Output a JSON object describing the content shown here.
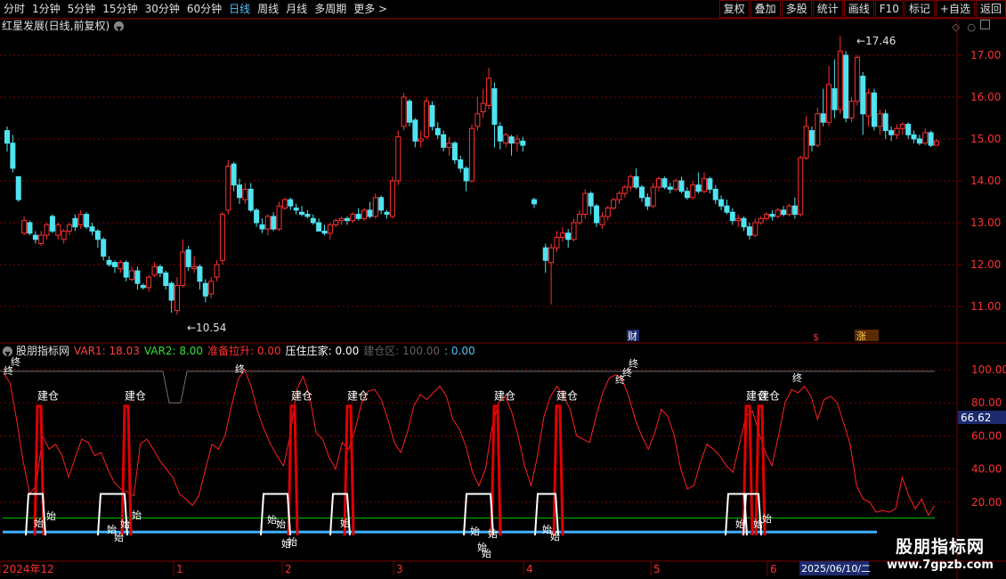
{
  "toolbar": {
    "periods": [
      "分时",
      "1分钟",
      "5分钟",
      "15分钟",
      "30分钟",
      "60分钟",
      "日线",
      "周线",
      "月线",
      "多周期",
      "更多 >"
    ],
    "active_period": "日线",
    "buttons": [
      "复权",
      "叠加",
      "多股",
      "统计",
      "画线",
      "F10",
      "标记",
      "+自选",
      "返回"
    ]
  },
  "chart_title": "红星发展(日线,前复权)",
  "indicator": {
    "name": "股朋指标网",
    "var1": "VAR1: 18.03",
    "var2": "VAR2: 8.00",
    "prep": "准备拉升: 0.00",
    "press": "压住庄家: 0.00",
    "build": "建仓区: 100.00",
    "extra": ": 0.00"
  },
  "price_axis": [
    "17.00",
    "16.00",
    "15.00",
    "14.00",
    "13.00",
    "12.00",
    "11.00"
  ],
  "ind_axis": [
    "100.00",
    "80.00",
    "60.00",
    "40.00",
    "20.00"
  ],
  "ind_current": "66.62",
  "hi_label": "17.46",
  "lo_label": "10.54",
  "markers": {
    "cai": "财",
    "s": "$",
    "zhang": "涨"
  },
  "signals": {
    "jian": "建仓",
    "shi": "始",
    "zhong": "终"
  },
  "date_axis": [
    "2024年12",
    "1",
    "2",
    "3",
    "4",
    "5",
    "6"
  ],
  "date_current": "2025/06/10/二",
  "watermark": {
    "line1": "股朋指标网",
    "line2": "www.7gpzb.com"
  },
  "colors": {
    "up": "#ff3030",
    "down": "#4fe3f0",
    "grid": "#7a0000",
    "ma": "#ff2020",
    "green": "#00c000",
    "blue": "#3fb0ff"
  },
  "candles": [
    [
      15.2,
      14.9,
      15.3,
      14.7
    ],
    [
      14.9,
      14.3,
      15.1,
      14.2
    ],
    [
      14.1,
      13.55,
      14.1,
      13.5
    ],
    [
      12.75,
      13.05,
      13.15,
      12.7
    ],
    [
      13.0,
      12.75,
      13.05,
      12.7
    ],
    [
      12.7,
      12.6,
      12.8,
      12.5
    ],
    [
      12.5,
      12.7,
      12.8,
      12.45
    ],
    [
      12.7,
      12.95,
      13.0,
      12.6
    ],
    [
      13.15,
      12.8,
      13.2,
      12.75
    ],
    [
      12.7,
      12.95,
      13.0,
      12.6
    ],
    [
      12.6,
      12.8,
      12.85,
      12.5
    ],
    [
      12.8,
      12.95,
      13.0,
      12.7
    ],
    [
      13.1,
      12.9,
      13.2,
      12.8
    ],
    [
      12.95,
      13.2,
      13.3,
      12.85
    ],
    [
      13.2,
      12.9,
      13.25,
      12.85
    ],
    [
      12.9,
      12.8,
      13.0,
      12.7
    ],
    [
      12.8,
      12.6,
      12.85,
      12.4
    ],
    [
      12.6,
      12.2,
      12.65,
      12.1
    ],
    [
      12.1,
      12.0,
      12.2,
      11.95
    ],
    [
      12.05,
      11.95,
      12.1,
      11.8
    ],
    [
      11.9,
      12.05,
      12.1,
      11.8
    ],
    [
      12.05,
      11.7,
      12.1,
      11.6
    ],
    [
      11.65,
      11.85,
      11.95,
      11.6
    ],
    [
      11.85,
      11.55,
      11.95,
      11.4
    ],
    [
      11.5,
      11.45,
      11.55,
      11.4
    ],
    [
      11.45,
      11.7,
      11.75,
      11.35
    ],
    [
      11.75,
      11.95,
      12.05,
      11.7
    ],
    [
      11.95,
      11.8,
      12.0,
      11.7
    ],
    [
      11.8,
      11.5,
      11.85,
      11.4
    ],
    [
      11.55,
      11.15,
      11.6,
      10.85
    ],
    [
      10.9,
      11.5,
      11.7,
      10.8
    ],
    [
      11.5,
      12.3,
      12.6,
      11.45
    ],
    [
      12.35,
      11.95,
      12.45,
      11.85
    ],
    [
      11.9,
      11.95,
      12.2,
      11.8
    ],
    [
      11.95,
      11.6,
      12.0,
      11.4
    ],
    [
      11.55,
      11.25,
      11.65,
      11.1
    ],
    [
      11.3,
      11.6,
      11.7,
      11.2
    ],
    [
      11.7,
      12.0,
      12.1,
      11.6
    ],
    [
      12.1,
      13.2,
      13.25,
      12.0
    ],
    [
      13.3,
      14.35,
      14.5,
      13.2
    ],
    [
      14.4,
      13.9,
      14.45,
      13.75
    ],
    [
      13.9,
      13.6,
      14.05,
      13.45
    ],
    [
      13.55,
      13.8,
      13.95,
      13.45
    ],
    [
      13.8,
      13.3,
      13.95,
      13.25
    ],
    [
      13.3,
      13.0,
      13.35,
      12.9
    ],
    [
      12.95,
      12.85,
      13.1,
      12.75
    ],
    [
      12.85,
      13.15,
      13.2,
      12.7
    ],
    [
      13.15,
      12.85,
      13.25,
      12.8
    ],
    [
      12.85,
      13.4,
      13.5,
      12.8
    ],
    [
      13.35,
      13.55,
      13.6,
      13.3
    ],
    [
      13.55,
      13.4,
      13.6,
      13.3
    ],
    [
      13.35,
      13.3,
      13.45,
      13.2
    ],
    [
      13.25,
      13.2,
      13.4,
      13.15
    ],
    [
      13.2,
      13.15,
      13.3,
      13.1
    ],
    [
      13.1,
      13.0,
      13.2,
      12.95
    ],
    [
      13.0,
      12.8,
      13.1,
      12.8
    ],
    [
      12.8,
      12.75,
      12.95,
      12.7
    ],
    [
      12.75,
      12.95,
      13.0,
      12.6
    ],
    [
      12.95,
      13.05,
      13.1,
      12.9
    ],
    [
      13.05,
      13.1,
      13.15,
      12.95
    ],
    [
      13.1,
      13.05,
      13.15,
      12.95
    ],
    [
      13.05,
      13.2,
      13.25,
      13.0
    ],
    [
      13.2,
      13.1,
      13.35,
      13.05
    ],
    [
      13.1,
      13.3,
      13.35,
      13.05
    ],
    [
      13.3,
      13.15,
      13.5,
      13.1
    ],
    [
      13.15,
      13.6,
      13.7,
      13.1
    ],
    [
      13.6,
      13.3,
      13.65,
      13.2
    ],
    [
      13.25,
      13.2,
      13.3,
      13.1
    ],
    [
      13.15,
      14.0,
      14.1,
      13.1
    ],
    [
      14.0,
      15.05,
      15.2,
      13.9
    ],
    [
      15.3,
      16.0,
      16.1,
      15.2
    ],
    [
      15.9,
      15.4,
      15.95,
      15.3
    ],
    [
      15.45,
      14.95,
      15.5,
      14.8
    ],
    [
      14.95,
      15.0,
      15.2,
      14.8
    ],
    [
      15.05,
      15.9,
      16.0,
      15.0
    ],
    [
      15.8,
      15.3,
      15.9,
      15.2
    ],
    [
      15.25,
      15.1,
      15.4,
      15.0
    ],
    [
      15.1,
      14.8,
      15.2,
      14.7
    ],
    [
      14.8,
      14.9,
      15.05,
      14.6
    ],
    [
      14.9,
      14.5,
      14.95,
      14.4
    ],
    [
      14.5,
      14.3,
      14.6,
      14.2
    ],
    [
      14.3,
      14.0,
      14.35,
      13.75
    ],
    [
      14.0,
      15.25,
      15.35,
      13.95
    ],
    [
      15.3,
      15.6,
      16.0,
      15.2
    ],
    [
      15.65,
      15.85,
      16.2,
      15.5
    ],
    [
      15.8,
      16.45,
      16.7,
      15.7
    ],
    [
      16.2,
      15.35,
      16.35,
      14.8
    ],
    [
      15.3,
      14.95,
      15.4,
      14.75
    ],
    [
      14.9,
      15.1,
      15.15,
      14.8
    ],
    [
      15.05,
      14.9,
      15.1,
      14.6
    ],
    [
      14.9,
      15.0,
      15.1,
      14.7
    ],
    [
      14.95,
      14.85,
      15.05,
      14.7
    ],
    [
      null,
      null,
      null,
      null
    ],
    [
      13.55,
      13.45,
      13.6,
      13.35
    ],
    [
      null,
      null,
      null,
      null
    ],
    [
      12.4,
      12.1,
      12.5,
      11.8
    ],
    [
      12.05,
      12.4,
      12.5,
      11.05
    ],
    [
      12.4,
      12.65,
      12.8,
      12.3
    ],
    [
      12.65,
      12.75,
      12.9,
      12.55
    ],
    [
      12.75,
      12.6,
      12.85,
      12.4
    ],
    [
      12.6,
      13.0,
      13.1,
      12.55
    ],
    [
      13.0,
      13.2,
      13.3,
      12.95
    ],
    [
      13.2,
      13.7,
      13.8,
      13.1
    ],
    [
      13.7,
      13.4,
      13.75,
      13.2
    ],
    [
      13.4,
      13.0,
      13.45,
      12.9
    ],
    [
      12.95,
      13.15,
      13.25,
      12.85
    ],
    [
      13.15,
      13.35,
      13.4,
      13.05
    ],
    [
      13.35,
      13.55,
      13.6,
      13.3
    ],
    [
      13.55,
      13.7,
      13.75,
      13.45
    ],
    [
      13.7,
      13.85,
      13.9,
      13.6
    ],
    [
      13.85,
      14.1,
      14.15,
      13.75
    ],
    [
      14.1,
      13.85,
      14.3,
      13.8
    ],
    [
      13.85,
      13.6,
      13.9,
      13.5
    ],
    [
      13.6,
      13.4,
      13.7,
      13.3
    ],
    [
      13.4,
      13.85,
      13.95,
      13.35
    ],
    [
      13.85,
      14.05,
      14.1,
      13.75
    ],
    [
      14.05,
      13.85,
      14.1,
      13.8
    ],
    [
      13.85,
      13.8,
      13.95,
      13.7
    ],
    [
      13.8,
      14.0,
      14.05,
      13.75
    ],
    [
      14.0,
      13.75,
      14.1,
      13.7
    ],
    [
      13.75,
      13.6,
      13.85,
      13.55
    ],
    [
      13.6,
      13.9,
      14.0,
      13.55
    ],
    [
      13.9,
      13.75,
      14.2,
      13.7
    ],
    [
      13.75,
      14.05,
      14.2,
      13.7
    ],
    [
      14.05,
      13.8,
      14.1,
      13.7
    ],
    [
      13.8,
      13.55,
      13.9,
      13.45
    ],
    [
      13.55,
      13.4,
      13.65,
      13.3
    ],
    [
      13.4,
      13.25,
      13.55,
      13.2
    ],
    [
      13.25,
      13.05,
      13.35,
      12.95
    ],
    [
      13.05,
      13.1,
      13.2,
      12.9
    ],
    [
      13.1,
      12.9,
      13.15,
      12.8
    ],
    [
      12.9,
      12.7,
      13.0,
      12.6
    ],
    [
      12.7,
      13.0,
      13.1,
      12.65
    ],
    [
      13.0,
      13.1,
      13.15,
      12.95
    ],
    [
      13.1,
      13.2,
      13.25,
      13.05
    ],
    [
      13.2,
      13.15,
      13.3,
      13.05
    ],
    [
      13.15,
      13.3,
      13.35,
      13.1
    ],
    [
      13.3,
      13.2,
      13.4,
      13.15
    ],
    [
      13.2,
      13.4,
      13.45,
      13.15
    ],
    [
      13.4,
      13.2,
      13.6,
      13.1
    ],
    [
      13.2,
      14.55,
      14.6,
      13.15
    ],
    [
      14.55,
      15.3,
      15.55,
      14.5
    ],
    [
      15.2,
      14.85,
      15.3,
      14.7
    ],
    [
      14.85,
      15.6,
      15.75,
      14.8
    ],
    [
      15.6,
      15.4,
      16.2,
      15.3
    ],
    [
      15.4,
      16.3,
      16.75,
      15.3
    ],
    [
      16.2,
      15.7,
      16.9,
      15.5
    ],
    [
      15.7,
      17.1,
      17.46,
      15.6
    ],
    [
      17.0,
      15.5,
      17.1,
      15.4
    ],
    [
      15.5,
      15.9,
      16.0,
      15.4
    ],
    [
      15.9,
      16.95,
      17.0,
      15.8
    ],
    [
      16.5,
      15.6,
      16.6,
      15.1
    ],
    [
      15.55,
      16.1,
      16.2,
      15.3
    ],
    [
      16.1,
      15.3,
      16.2,
      15.2
    ],
    [
      15.3,
      15.6,
      15.7,
      15.1
    ],
    [
      15.6,
      15.2,
      15.7,
      15.0
    ],
    [
      15.2,
      15.1,
      15.3,
      14.95
    ],
    [
      15.1,
      15.25,
      15.35,
      15.0
    ],
    [
      15.25,
      15.35,
      15.4,
      15.1
    ],
    [
      15.35,
      15.1,
      15.4,
      15.0
    ],
    [
      15.1,
      15.0,
      15.2,
      14.9
    ],
    [
      15.0,
      14.9,
      15.1,
      14.85
    ],
    [
      14.9,
      15.15,
      15.25,
      14.85
    ],
    [
      15.15,
      14.85,
      15.2,
      14.8
    ],
    [
      14.85,
      14.95,
      15.0,
      14.85
    ]
  ],
  "osc": [
    98,
    92,
    70,
    45,
    25,
    30,
    60,
    52,
    55,
    48,
    35,
    47,
    58,
    56,
    48,
    50,
    40,
    32,
    28,
    26,
    24,
    55,
    58,
    52,
    45,
    40,
    35,
    25,
    22,
    18,
    24,
    40,
    55,
    52,
    60,
    78,
    94,
    100,
    90,
    75,
    64,
    55,
    48,
    42,
    60,
    88,
    96,
    84,
    62,
    58,
    47,
    40,
    56,
    52,
    64,
    80,
    87,
    88,
    82,
    70,
    56,
    50,
    62,
    78,
    85,
    82,
    86,
    90,
    84,
    70,
    64,
    54,
    38,
    30,
    40,
    65,
    80,
    84,
    75,
    60,
    42,
    30,
    48,
    72,
    84,
    90,
    84,
    76,
    60,
    58,
    56,
    72,
    86,
    95,
    97,
    94,
    84,
    70,
    60,
    52,
    62,
    76,
    72,
    60,
    40,
    28,
    30,
    44,
    55,
    52,
    48,
    42,
    38,
    55,
    72,
    75,
    62,
    50,
    42,
    60,
    80,
    88,
    86,
    90,
    84,
    70,
    82,
    84,
    80,
    68,
    55,
    30,
    22,
    20,
    14,
    15,
    14,
    16,
    35,
    24,
    16,
    22,
    12,
    18
  ]
}
